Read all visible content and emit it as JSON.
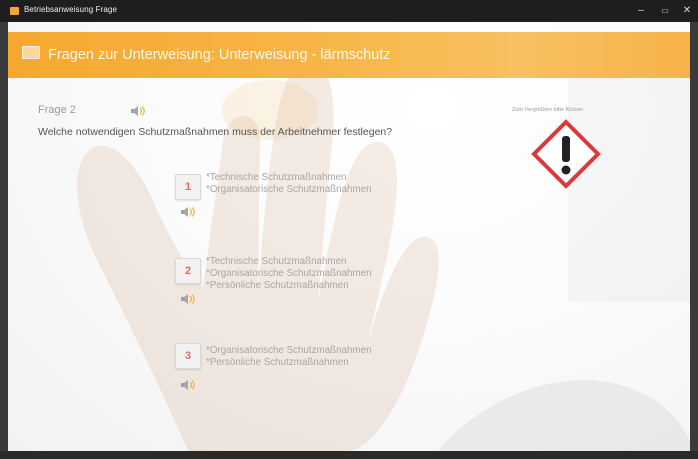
{
  "window": {
    "title": "Betriebsanweisung Frage",
    "controls": {
      "minimize": "–",
      "maximize": "▭",
      "close": "✕"
    }
  },
  "header": {
    "title": "Fragen zur Unterweisung: Unterweisung - lärmschutz"
  },
  "question": {
    "label": "Frage 2",
    "text": "Welche notwendigen Schutzmaßnahmen muss der Arbeitnehmer festlegen?"
  },
  "symbol": {
    "hint": "Zum Vergrößern bitte Klicken",
    "icon": "hazard-exclamation-icon"
  },
  "answers": [
    {
      "number": "1",
      "lines": [
        "*Technische Schutzmaßnahmen",
        "*Organisatorische Schutzmaßnahmen"
      ]
    },
    {
      "number": "2",
      "lines": [
        "*Technische Schutzmaßnahmen",
        "*Organisatorische Schutzmaßnahmen",
        "*Persönliche Schutzmaßnahmen"
      ]
    },
    {
      "number": "3",
      "lines": [
        "*Organisatorische Schutzmaßnahmen",
        "*Persönliche Schutzmaßnahmen"
      ]
    }
  ],
  "colors": {
    "header_orange": "#f5a82e",
    "answer_number_red": "#e06a6a",
    "hazard_red": "#d93a3a"
  }
}
